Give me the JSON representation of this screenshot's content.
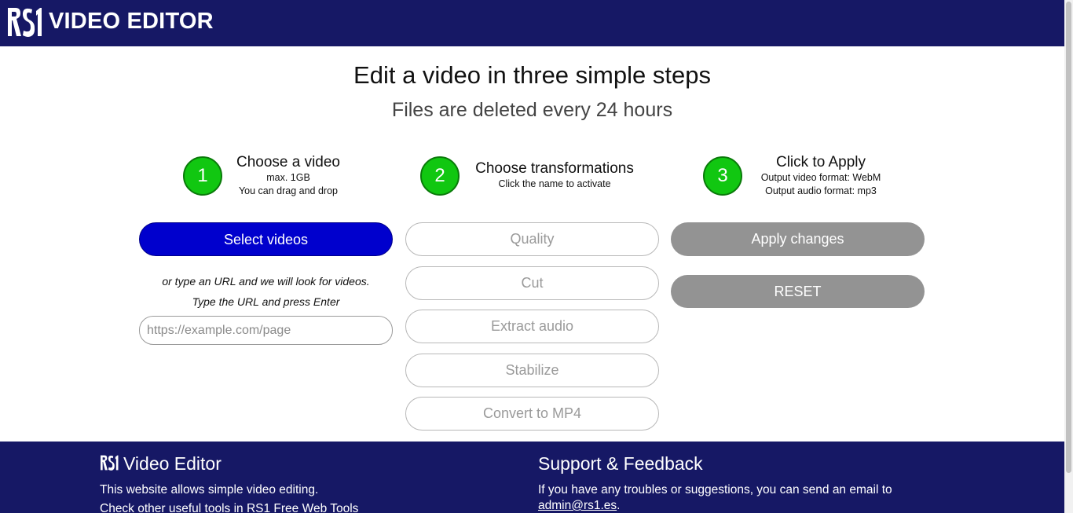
{
  "header": {
    "logo_text": "RS1",
    "title": "VIDEO EDITOR"
  },
  "hero": {
    "title": "Edit a video in three simple steps",
    "subtitle": "Files are deleted every 24 hours"
  },
  "steps": [
    {
      "number": "1",
      "title": "Choose a video",
      "lines": [
        "max. 1GB",
        "You can drag and drop"
      ]
    },
    {
      "number": "2",
      "title": "Choose transformations",
      "lines": [
        "Click the name to activate"
      ]
    },
    {
      "number": "3",
      "title": "Click to Apply",
      "lines": [
        "Output video format: WebM",
        "Output audio format: mp3"
      ]
    }
  ],
  "upload": {
    "select_label": "Select videos",
    "hint_line1": "or type an URL and we will look for videos.",
    "hint_line2": "Type the URL and press Enter",
    "url_placeholder": "https://example.com/page"
  },
  "transformations": [
    {
      "label": "Quality"
    },
    {
      "label": "Cut"
    },
    {
      "label": "Extract audio"
    },
    {
      "label": "Stabilize"
    },
    {
      "label": "Convert to MP4"
    }
  ],
  "actions": {
    "apply_label": "Apply changes",
    "reset_label": "RESET"
  },
  "footer": {
    "left_heading": "Video Editor",
    "left_line1": "This website allows simple video editing.",
    "left_line2": "Check other useful tools in RS1 Free Web Tools",
    "right_heading": "Support & Feedback",
    "right_line1": "If you have any troubles or suggestions, you can send an email to",
    "email": "admin@rs1.es",
    "email_suffix": "."
  },
  "colors": {
    "brand_navy": "#161865",
    "step_green": "#11c711",
    "primary_blue": "#0000cd",
    "disabled_grey": "#939393"
  }
}
